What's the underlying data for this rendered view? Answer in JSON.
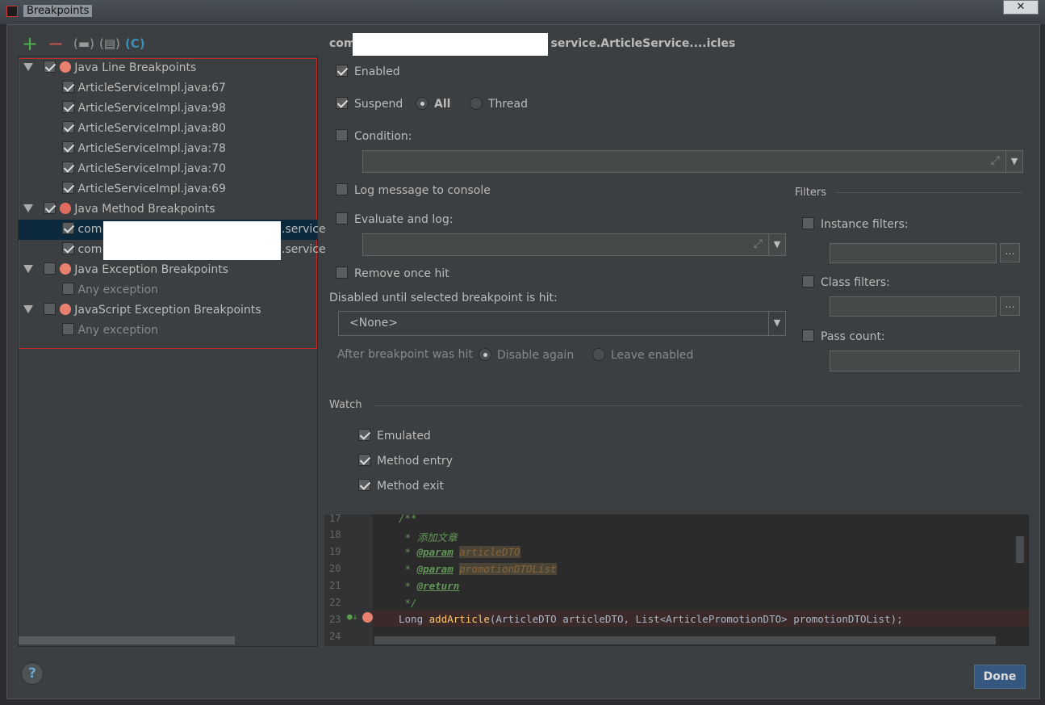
{
  "window": {
    "title": "Breakpoints",
    "close": "✕"
  },
  "toolbar": {
    "add": "+",
    "remove": "−",
    "icons": [
      "add-icon",
      "remove-icon",
      "folder-icon",
      "file-icon",
      "class-icon"
    ]
  },
  "tree": {
    "groups": [
      {
        "label": "Java Line Breakpoints",
        "checked": true,
        "items": [
          "ArticleServiceImpl.java:67",
          "ArticleServiceImpl.java:98",
          "ArticleServiceImpl.java:80",
          "ArticleServiceImpl.java:78",
          "ArticleServiceImpl.java:70",
          "ArticleServiceImpl.java:69"
        ]
      },
      {
        "label": "Java Method Breakpoints",
        "checked": true,
        "items": [
          "com",
          "com"
        ],
        "item_suffix": ".service"
      },
      {
        "label": "Java Exception Breakpoints",
        "checked": false,
        "items": [
          "Any exception"
        ]
      },
      {
        "label": "JavaScript Exception Breakpoints",
        "checked": false,
        "items": [
          "Any exception"
        ]
      }
    ]
  },
  "details": {
    "title_prefix": "com",
    "title_suffix": "service.ArticleService....icles",
    "enabled": "Enabled",
    "suspend": "Suspend",
    "all": "All",
    "thread": "Thread",
    "condition": "Condition:",
    "log_message": "Log message to console",
    "evaluate_log": "Evaluate and log:",
    "remove_once_hit": "Remove once hit",
    "disabled_until": "Disabled until selected breakpoint is hit:",
    "none_option": "<None>",
    "after_hit": "After breakpoint was hit",
    "disable_again": "Disable again",
    "leave_enabled": "Leave enabled",
    "filters": "Filters",
    "instance_filters": "Instance filters:",
    "class_filters": "Class filters:",
    "pass_count": "Pass count:",
    "watch": "Watch",
    "emulated": "Emulated",
    "method_entry": "Method entry",
    "method_exit": "Method exit"
  },
  "editor": {
    "line_numbers": [
      "17",
      "18",
      "19",
      "20",
      "21",
      "22",
      "23",
      "24"
    ],
    "l17": "/**",
    "l18": " * 添加文章",
    "star": " * ",
    "param": "@param",
    "p1": "articleDTO",
    "p2": "promotionDTOList",
    "ret": "@return",
    "l22": " */",
    "l23a": "Long ",
    "l23fn": "addArticle",
    "l23b": "(ArticleDTO articleDTO, List<ArticlePromotionDTO> promotionDTOList);"
  },
  "footer": {
    "help": "?",
    "done": "Done"
  },
  "colors": {
    "accent": "#365880",
    "breakpoint": "#e9806f",
    "add": "#4caf50",
    "remove": "#c75450"
  }
}
